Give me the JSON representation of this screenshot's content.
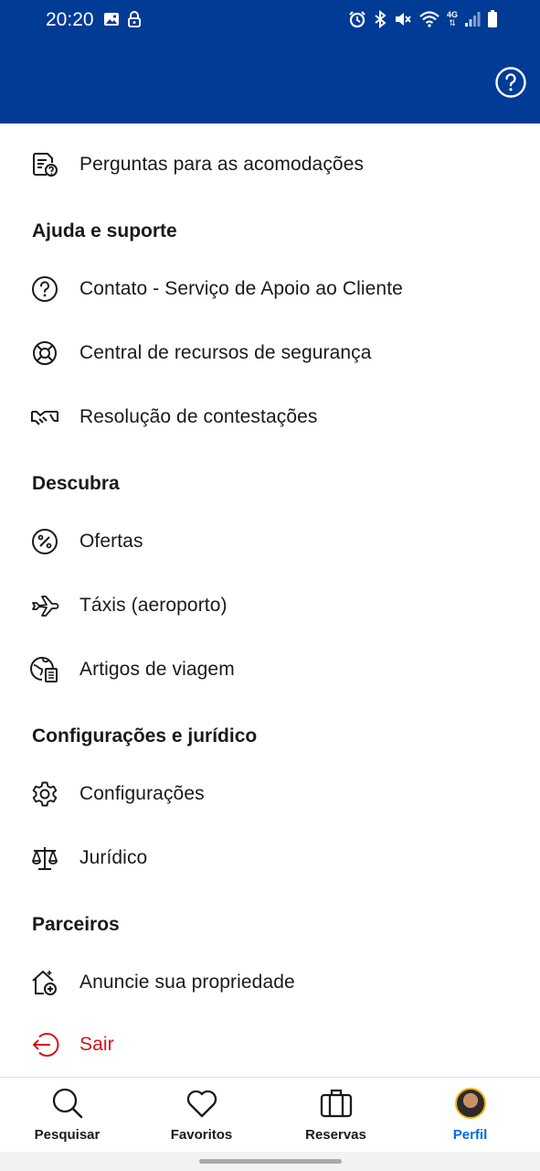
{
  "status_bar": {
    "time": "20:20",
    "network": "4G"
  },
  "header": {
    "background_color": "#003b95",
    "help_icon": "question-circle-icon"
  },
  "menu": {
    "top_item": {
      "label": "Perguntas para as acomodações",
      "icon": "document-question-icon"
    },
    "sections": [
      {
        "title": "Ajuda e suporte",
        "items": [
          {
            "label": "Contato - Serviço de Apoio ao Cliente",
            "icon": "question-circle-icon"
          },
          {
            "label": "Central de recursos de segurança",
            "icon": "lifebuoy-icon"
          },
          {
            "label": "Resolução de contestações",
            "icon": "handshake-icon"
          }
        ]
      },
      {
        "title": "Descubra",
        "items": [
          {
            "label": "Ofertas",
            "icon": "percent-icon"
          },
          {
            "label": "Táxis (aeroporto)",
            "icon": "airplane-icon"
          },
          {
            "label": "Artigos de viagem",
            "icon": "globe-article-icon"
          }
        ]
      },
      {
        "title": "Configurações e jurídico",
        "items": [
          {
            "label": "Configurações",
            "icon": "gear-icon"
          },
          {
            "label": "Jurídico",
            "icon": "scales-icon"
          }
        ]
      },
      {
        "title": "Parceiros",
        "items": [
          {
            "label": "Anuncie sua propriedade",
            "icon": "house-add-icon"
          }
        ]
      }
    ],
    "sign_out": {
      "label": "Sair",
      "icon": "sign-out-icon",
      "color": "#d4111e"
    }
  },
  "bottom_nav": {
    "items": [
      {
        "label": "Pesquisar",
        "icon": "search-icon"
      },
      {
        "label": "Favoritos",
        "icon": "heart-icon"
      },
      {
        "label": "Reservas",
        "icon": "suitcase-icon"
      },
      {
        "label": "Perfil",
        "icon": "avatar"
      }
    ],
    "active": "Perfil",
    "active_color": "#006ce4"
  }
}
